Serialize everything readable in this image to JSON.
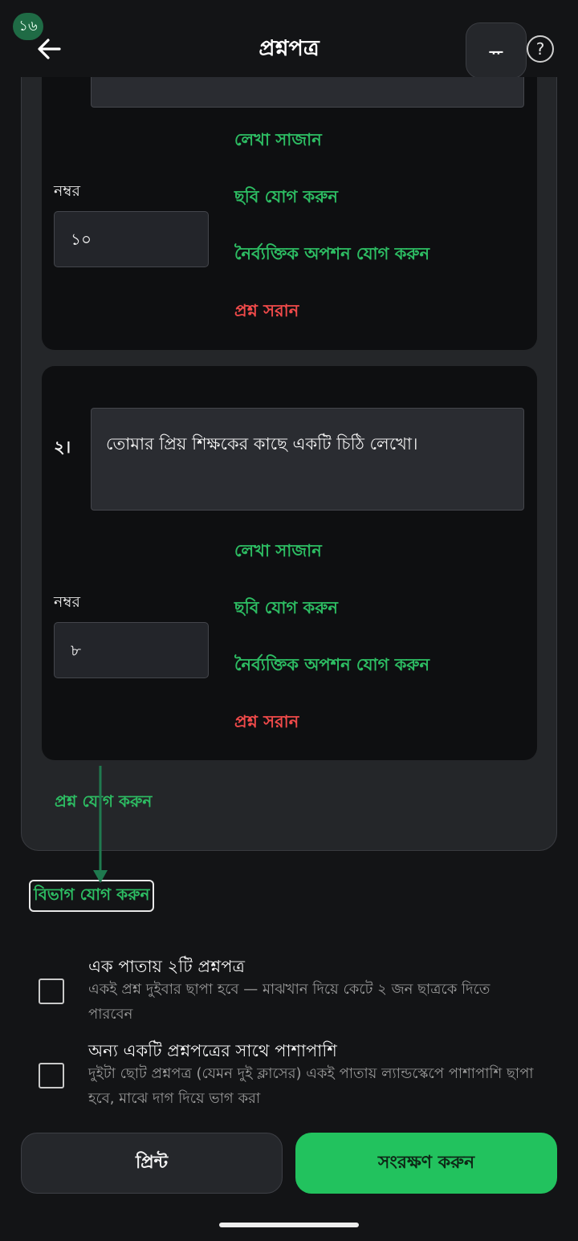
{
  "header": {
    "badge": "১৬",
    "title": "প্রশ্নপত্র",
    "text_size_label": "ᅲ",
    "help_label": "?"
  },
  "questions": [
    {
      "number": "",
      "text": "",
      "format_label": "লেখা সাজান",
      "marks_label": "নম্বর",
      "marks_value": "১০",
      "add_image_label": "ছবি যোগ করুন",
      "add_mcq_label": "নৈর্ব্যক্তিক অপশন যোগ করুন",
      "remove_label": "প্রশ্ন সরান"
    },
    {
      "number": "২।",
      "text": "তোমার প্রিয় শিক্ষকের কাছে একটি চিঠি লেখো।",
      "format_label": "লেখা সাজান",
      "marks_label": "নম্বর",
      "marks_value": "৮",
      "add_image_label": "ছবি যোগ করুন",
      "add_mcq_label": "নৈর্ব্যক্তিক অপশন যোগ করুন",
      "remove_label": "প্রশ্ন সরান"
    }
  ],
  "add_question_label": "প্রশ্ন যোগ করুন",
  "add_section_label": "বিভাগ যোগ করুন",
  "options": [
    {
      "title": "এক পাতায় ২টি প্রশ্নপত্র",
      "description": "একই প্রশ্ন দুইবার ছাপা হবে — মাঝখান দিয়ে কেটে ২ জন ছাত্রকে দিতে পারবেন",
      "checked": false
    },
    {
      "title": "অন্য একটি প্রশ্নপত্রের সাথে পাশাপাশি",
      "description": "দুইটা ছোট প্রশ্নপত্র (যেমন দুই ক্লাসের) একই পাতায় ল্যান্ডস্কেপে পাশাপাশি ছাপা হবে, মাঝে দাগ দিয়ে ভাগ করা",
      "checked": false
    }
  ],
  "footer": {
    "print_label": "প্রিন্ট",
    "save_label": "সংরক্ষণ করুন"
  },
  "colors": {
    "accent_green": "#22c25e",
    "link_green": "#2dbd63",
    "danger_red": "#ef4a4a",
    "background": "#131416"
  }
}
